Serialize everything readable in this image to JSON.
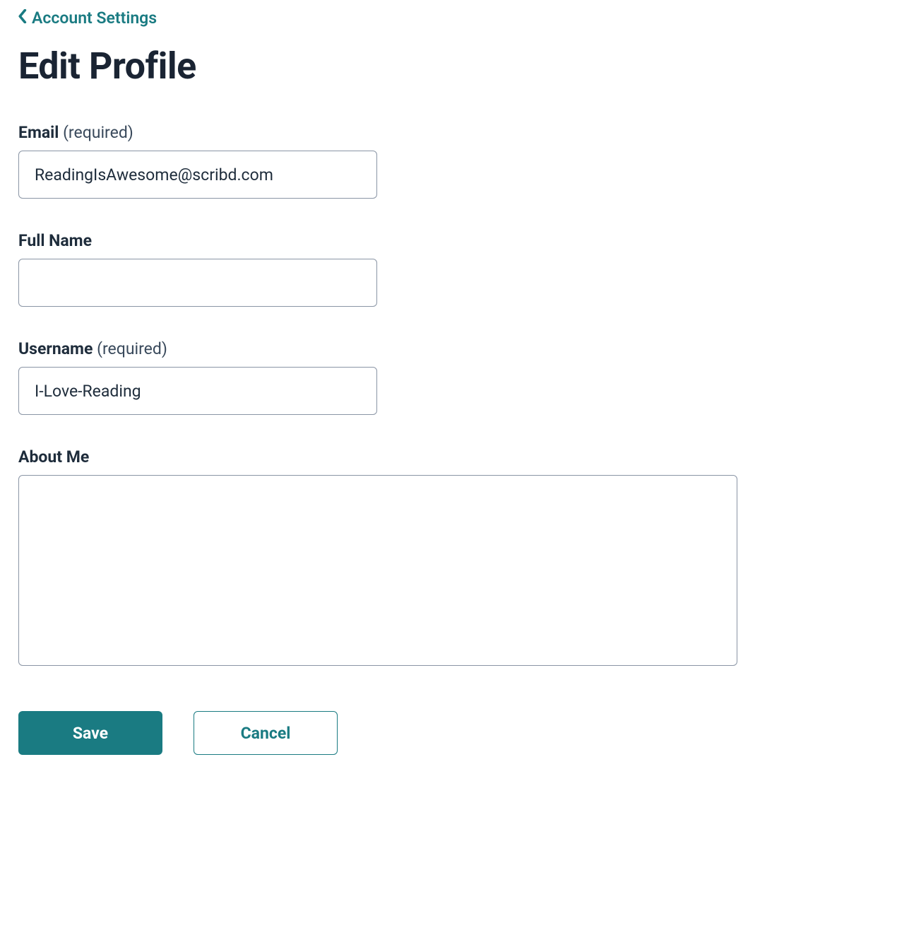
{
  "nav": {
    "back_label": "Account Settings"
  },
  "page": {
    "title": "Edit Profile"
  },
  "form": {
    "email": {
      "label": "Email",
      "suffix": "(required)",
      "value": "ReadingIsAwesome@scribd.com"
    },
    "full_name": {
      "label": "Full Name",
      "value": ""
    },
    "username": {
      "label": "Username",
      "suffix": "(required)",
      "value": "I-Love-Reading"
    },
    "about_me": {
      "label": "About Me",
      "value": ""
    }
  },
  "buttons": {
    "save": "Save",
    "cancel": "Cancel"
  }
}
